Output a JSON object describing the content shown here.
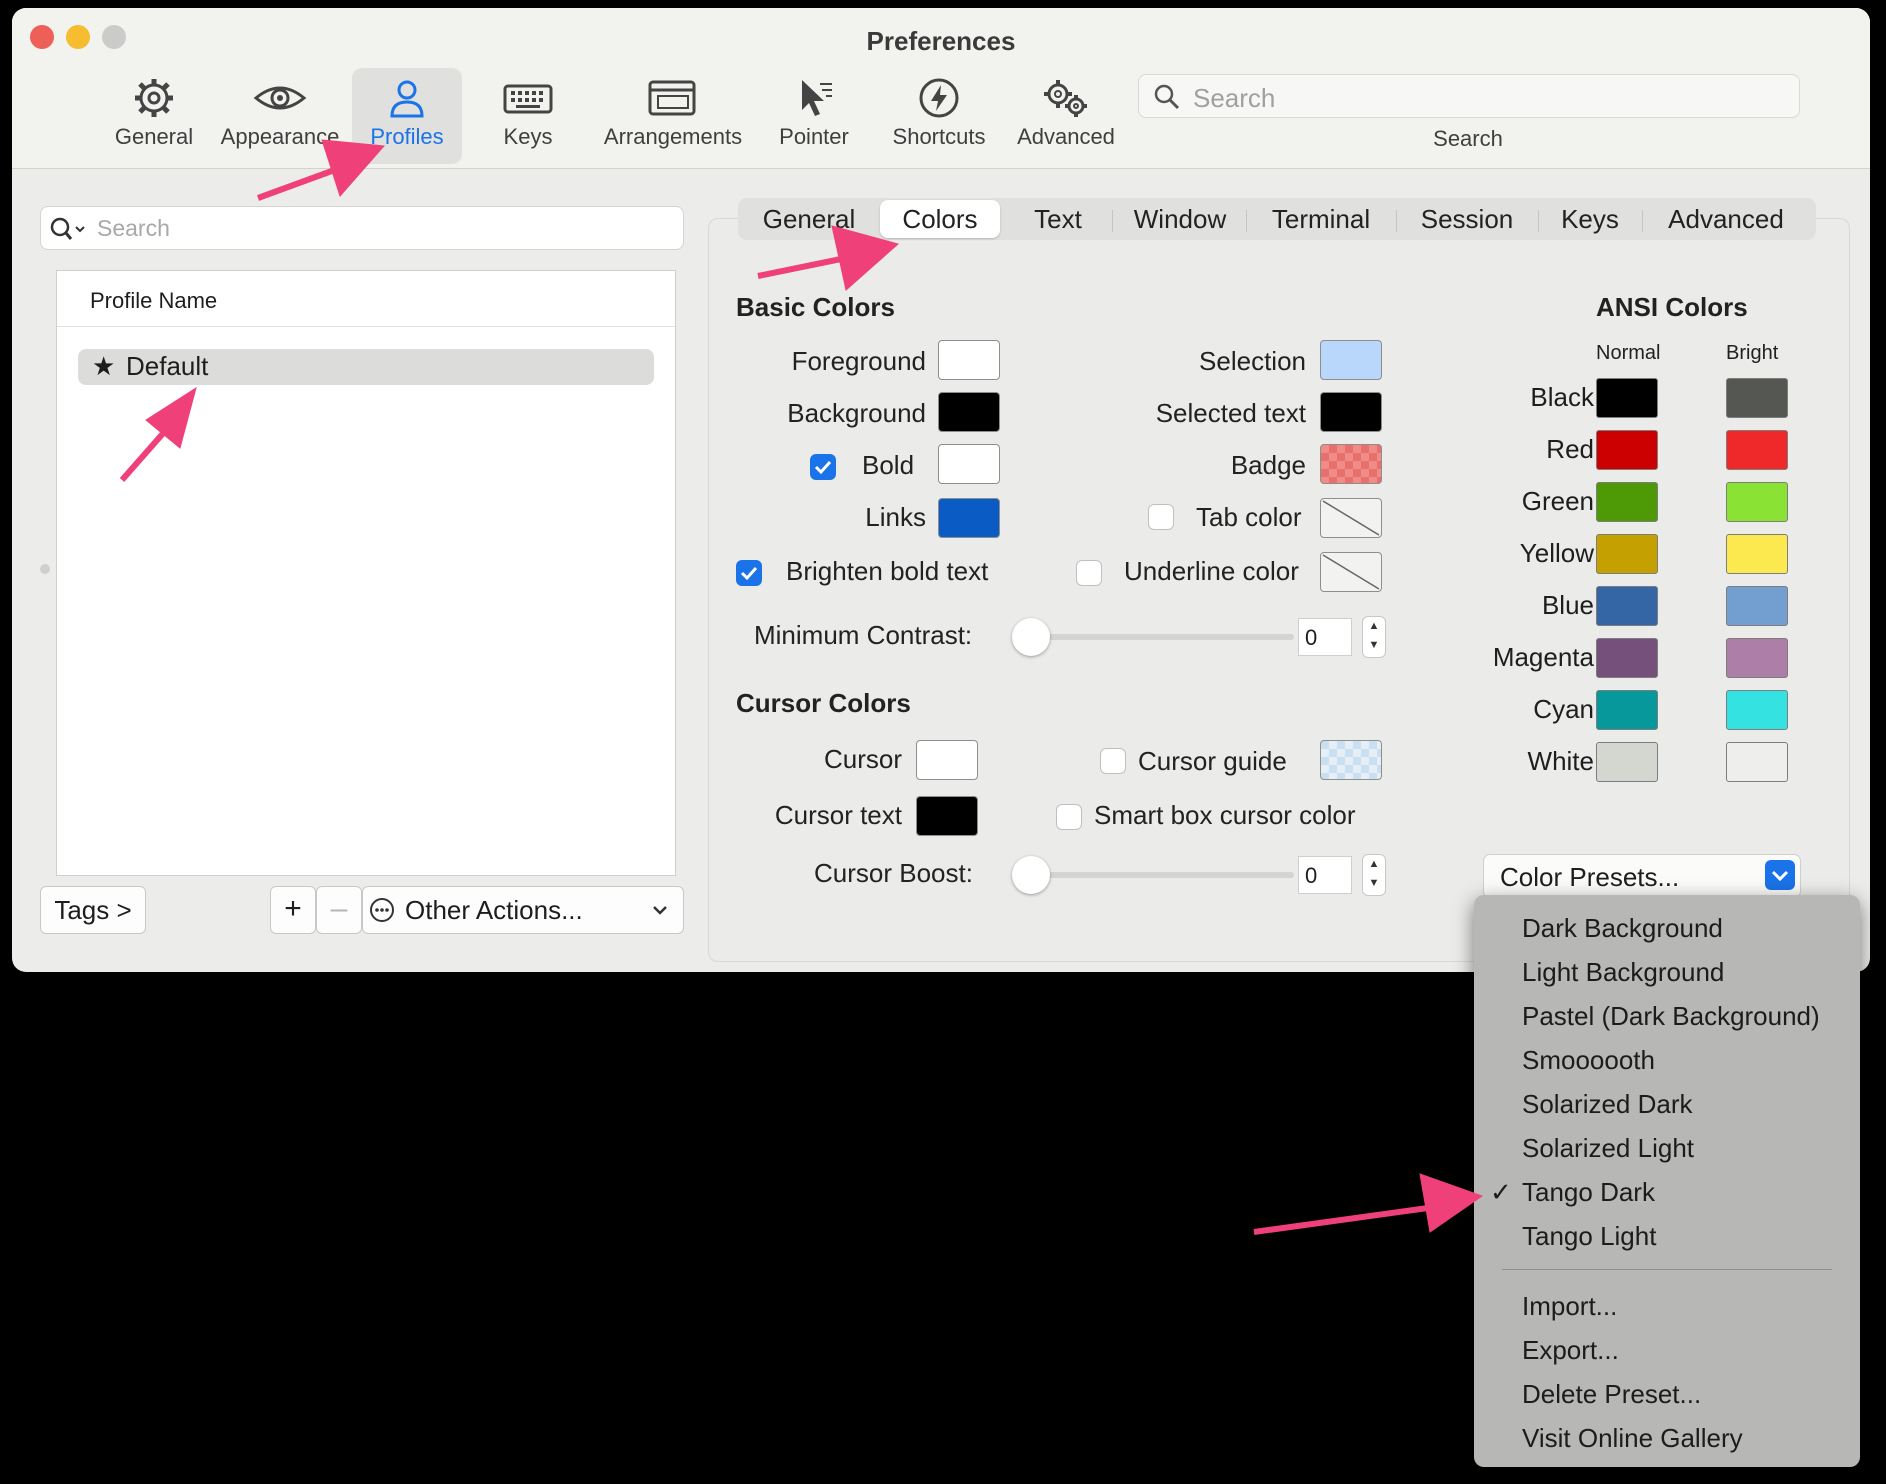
{
  "window": {
    "title": "Preferences"
  },
  "toolbar": {
    "items": [
      {
        "label": "General",
        "icon": "gear-icon"
      },
      {
        "label": "Appearance",
        "icon": "eye-icon"
      },
      {
        "label": "Profiles",
        "icon": "person-icon",
        "selected": true
      },
      {
        "label": "Keys",
        "icon": "keyboard-icon"
      },
      {
        "label": "Arrangements",
        "icon": "windows-icon"
      },
      {
        "label": "Pointer",
        "icon": "pointer-icon"
      },
      {
        "label": "Shortcuts",
        "icon": "bolt-icon"
      },
      {
        "label": "Advanced",
        "icon": "gears-icon"
      }
    ],
    "search_placeholder": "Search",
    "search_label": "Search"
  },
  "profiles": {
    "search_placeholder": "Search",
    "column_header": "Profile Name",
    "rows": [
      {
        "name": "Default",
        "default_star": "★"
      }
    ],
    "tags_button": "Tags >",
    "add_button": "+",
    "remove_button": "–",
    "other_actions": "Other Actions..."
  },
  "tabs": [
    "General",
    "Colors",
    "Text",
    "Window",
    "Terminal",
    "Session",
    "Keys",
    "Advanced"
  ],
  "selected_tab": "Colors",
  "basic_colors": {
    "heading": "Basic Colors",
    "foreground": {
      "label": "Foreground",
      "color": "#ffffff"
    },
    "background": {
      "label": "Background",
      "color": "#000000"
    },
    "bold": {
      "label": "Bold",
      "color": "#ffffff",
      "checked": true
    },
    "links": {
      "label": "Links",
      "color": "#0a5bc4"
    },
    "brighten_bold": {
      "label": "Brighten bold text",
      "checked": true
    },
    "selection": {
      "label": "Selection",
      "color": "#b8d7fb"
    },
    "selected_text": {
      "label": "Selected text",
      "color": "#000000"
    },
    "badge": {
      "label": "Badge",
      "color": "#f08c88"
    },
    "tab_color": {
      "label": "Tab color",
      "checked": false
    },
    "underline_color": {
      "label": "Underline color",
      "checked": false
    },
    "min_contrast": {
      "label": "Minimum Contrast:",
      "value": "0"
    }
  },
  "cursor_colors": {
    "heading": "Cursor Colors",
    "cursor": {
      "label": "Cursor",
      "color": "#ffffff"
    },
    "cursor_text": {
      "label": "Cursor text",
      "color": "#000000"
    },
    "cursor_guide": {
      "label": "Cursor guide",
      "checked": false,
      "color": "#cfe3f5"
    },
    "smart_box": {
      "label": "Smart box cursor color",
      "checked": false
    },
    "boost": {
      "label": "Cursor Boost:",
      "value": "0"
    }
  },
  "ansi": {
    "heading": "ANSI Colors",
    "col_normal": "Normal",
    "col_bright": "Bright",
    "rows": [
      {
        "name": "Black",
        "normal": "#000000",
        "bright": "#555753"
      },
      {
        "name": "Red",
        "normal": "#cc0000",
        "bright": "#ef2929"
      },
      {
        "name": "Green",
        "normal": "#4e9a06",
        "bright": "#8ae234"
      },
      {
        "name": "Yellow",
        "normal": "#c4a000",
        "bright": "#fce94f"
      },
      {
        "name": "Blue",
        "normal": "#3465a4",
        "bright": "#729fcf"
      },
      {
        "name": "Magenta",
        "normal": "#75507b",
        "bright": "#ad7fa8"
      },
      {
        "name": "Cyan",
        "normal": "#06989a",
        "bright": "#34e2e2"
      },
      {
        "name": "White",
        "normal": "#d3d7cf",
        "bright": "#eeeeec"
      }
    ]
  },
  "presets": {
    "button_label": "Color Presets...",
    "menu_items": [
      "Dark Background",
      "Light Background",
      "Pastel (Dark Background)",
      "Smoooooth",
      "Solarized Dark",
      "Solarized Light",
      "Tango Dark",
      "Tango Light"
    ],
    "checked_item": "Tango Dark",
    "check_mark": "✓",
    "actions": [
      "Import...",
      "Export...",
      "Delete Preset...",
      "Visit Online Gallery"
    ]
  },
  "colors": {
    "accent": "#1a73e8",
    "annotation_arrow": "#f0407a"
  }
}
